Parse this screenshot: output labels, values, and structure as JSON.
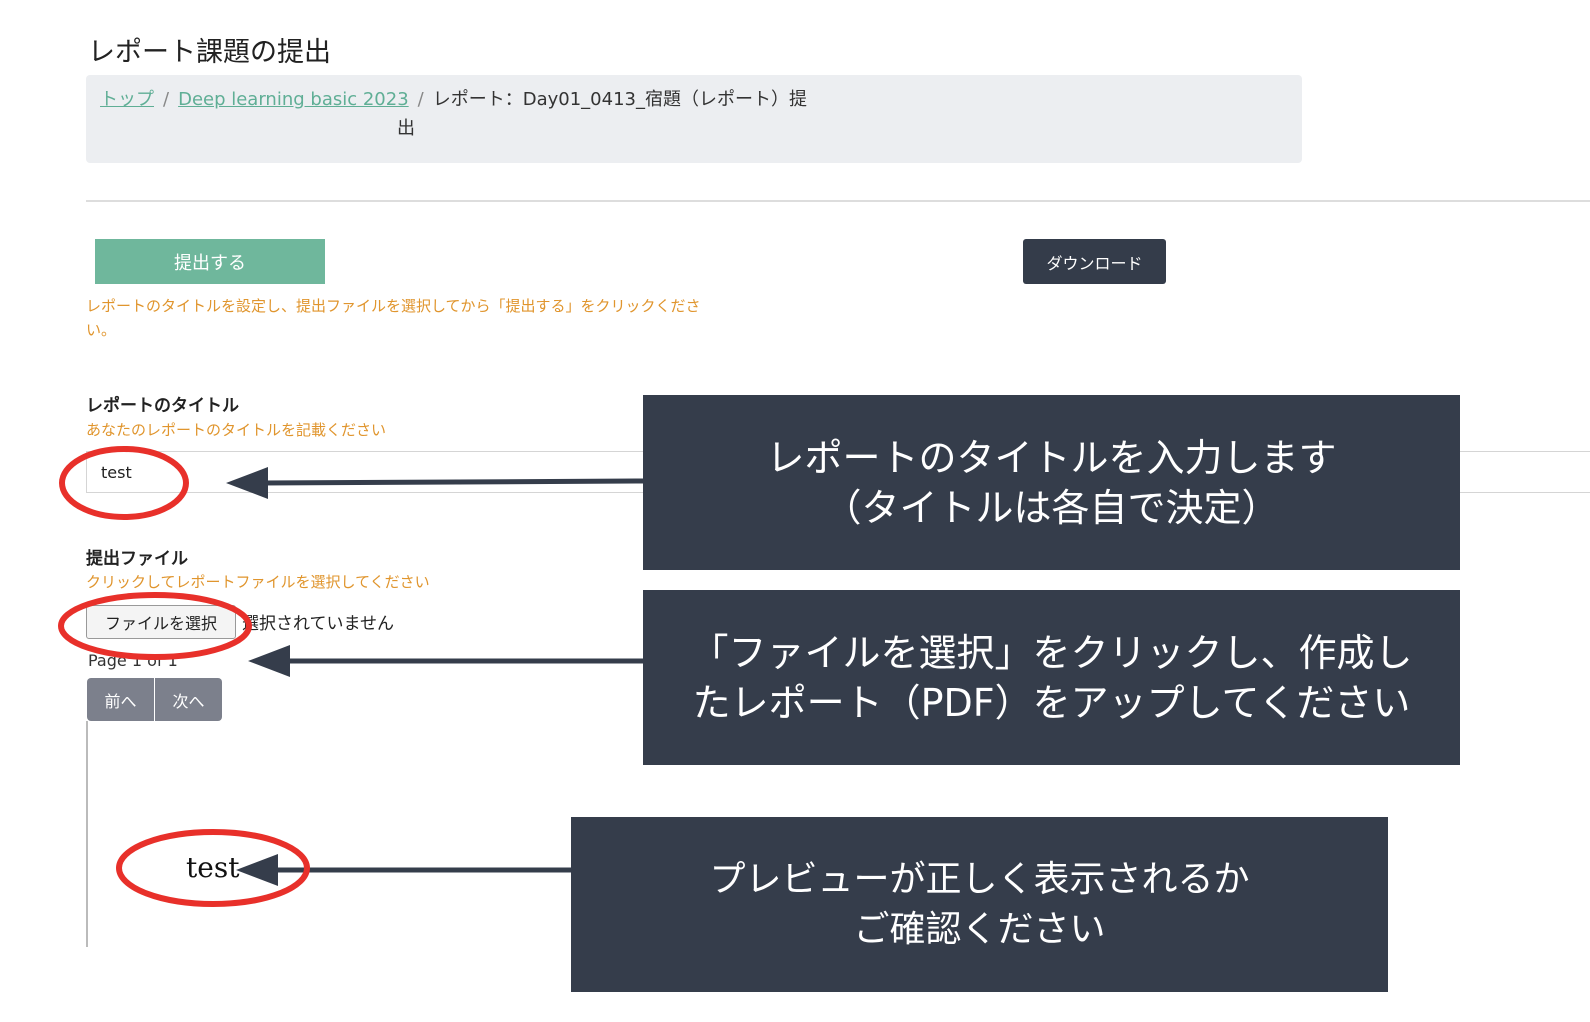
{
  "page": {
    "title": "レポート課題の提出"
  },
  "breadcrumb": {
    "home": "トップ",
    "separator": "/",
    "course": "Deep learning basic 2023",
    "current_line1": "レポート：Day01_0413_宿題（レポート）提",
    "current_line2": "出"
  },
  "actions": {
    "submit_label": "提出する",
    "download_label": "ダウンロード",
    "submit_hint": "レポートのタイトルを設定し、提出ファイルを選択してから「提出する」をクリックください。"
  },
  "report_title": {
    "label": "レポートのタイトル",
    "hint": "あなたのレポートのタイトルを記載ください",
    "value": "test"
  },
  "submit_file": {
    "label": "提出ファイル",
    "hint": "クリックしてレポートファイルを選択してください",
    "choose_label": "ファイルを選択",
    "status": "選択されていません"
  },
  "pager": {
    "page_text": "Page 1 of 1",
    "prev_label": "前へ",
    "next_label": "次へ"
  },
  "preview": {
    "text": "test"
  },
  "annotations": {
    "callout1_line1": "レポートのタイトルを入力します",
    "callout1_line2": "（タイトルは各自で決定）",
    "callout2_line1": "「ファイルを選択」をクリックし、作成し",
    "callout2_line2": "たレポート（PDF）をアップしてください",
    "callout3_line1": "プレビューが正しく表示されるか",
    "callout3_line2": "ご確認ください",
    "highlight_color": "#e8302a",
    "callout_bg": "#353d4b",
    "accent_color": "#6fb79c",
    "hint_color": "#e0952d"
  }
}
